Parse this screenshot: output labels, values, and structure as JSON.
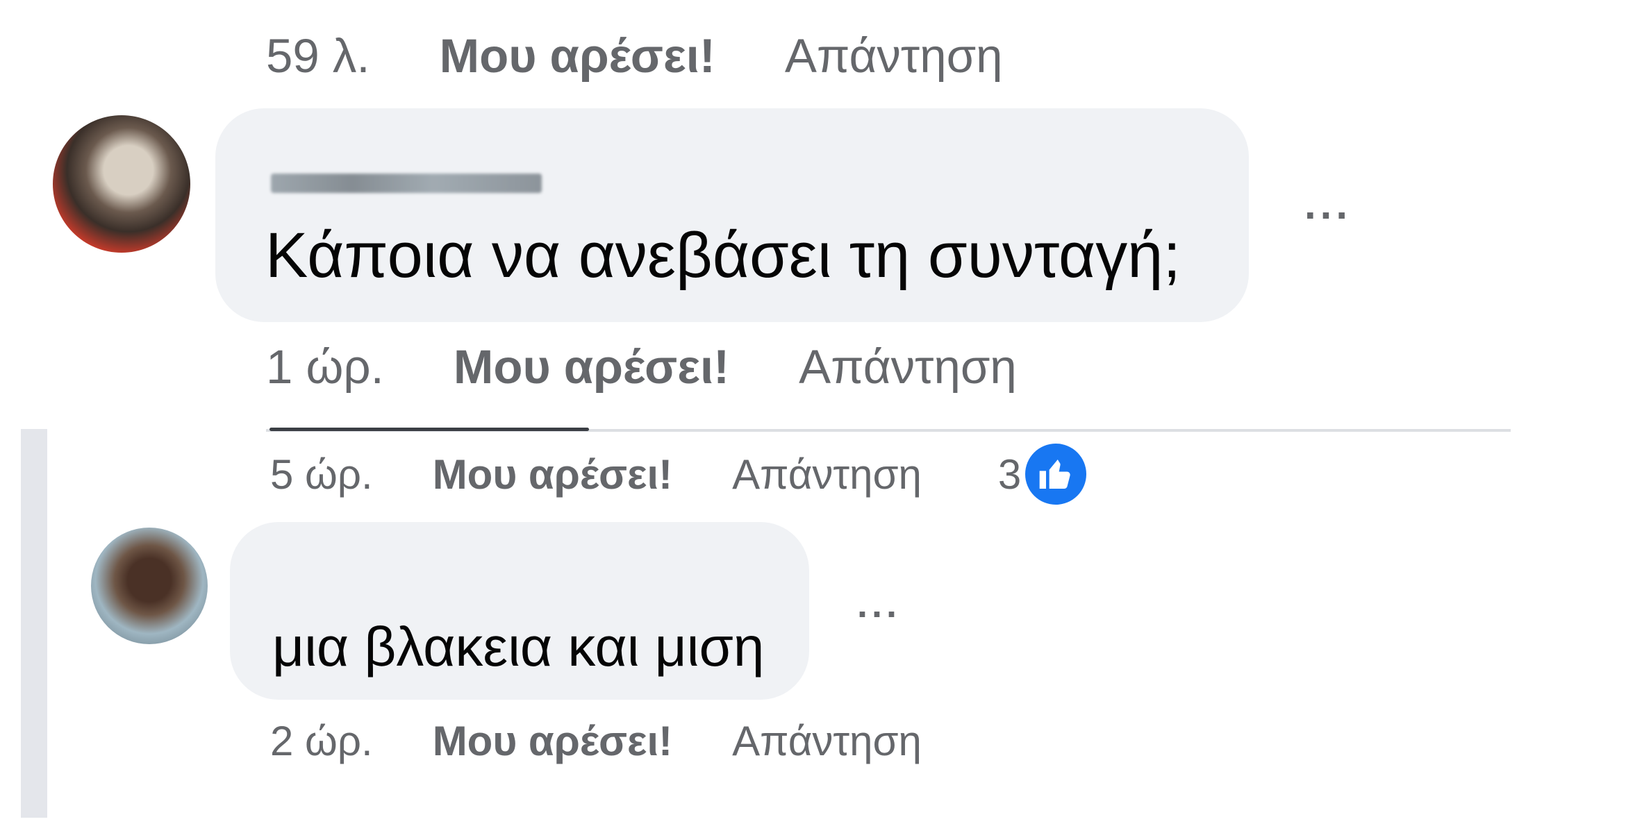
{
  "comments": [
    {
      "time": "59 λ.",
      "like_label": "Μου αρέσει!",
      "reply_label": "Απάντηση"
    },
    {
      "author": "",
      "text": "Κάποια να ανεβάσει τη συνταγή;",
      "menu_label": "...",
      "time": "1 ώρ.",
      "like_label": "Μου αρέσει!",
      "reply_label": "Απάντηση"
    }
  ],
  "replies": [
    {
      "time": "5 ώρ.",
      "like_label": "Μου αρέσει!",
      "reply_label": "Απάντηση",
      "reaction_count": "3",
      "reaction_icon": "thumbs-up-icon",
      "reaction_color": "#1877f2"
    },
    {
      "author": "",
      "text": "μια βλακεια και μιση",
      "menu_label": "...",
      "time": "2 ώρ.",
      "like_label": "Μου αρέσει!",
      "reply_label": "Απάντηση"
    }
  ],
  "colors": {
    "bubble": "#f0f2f5",
    "meta_text": "#65676b",
    "body_text": "#050505",
    "accent": "#1877f2"
  }
}
